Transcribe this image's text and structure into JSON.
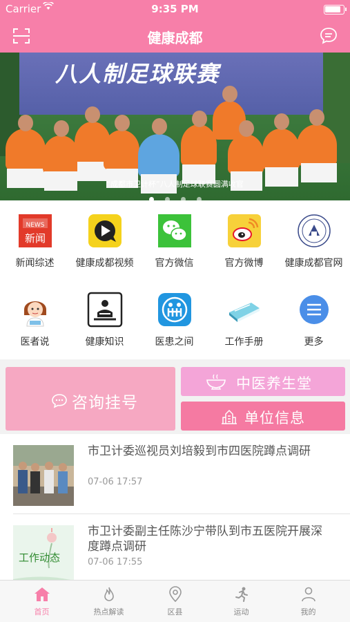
{
  "status": {
    "carrier": "Carrier",
    "time": "9:35 PM"
  },
  "nav": {
    "title": "健康成都"
  },
  "banner": {
    "sign_text": "八人制足球联赛",
    "caption": "“成都市卫计杯”八人制足球联赛圆满收官",
    "page_count": 4,
    "active_page": 1
  },
  "grid": {
    "items": [
      {
        "label": "新闻综述",
        "icon": "news-icon"
      },
      {
        "label": "健康成都视频",
        "icon": "video-icon"
      },
      {
        "label": "官方微信",
        "icon": "wechat-icon"
      },
      {
        "label": "官方微博",
        "icon": "weibo-icon"
      },
      {
        "label": "健康成都官网",
        "icon": "website-seal-icon"
      },
      {
        "label": "医者说",
        "icon": "doctor-avatar-icon"
      },
      {
        "label": "健康知识",
        "icon": "knowledge-icon"
      },
      {
        "label": "医患之间",
        "icon": "doctor-patient-icon"
      },
      {
        "label": "工作手册",
        "icon": "handbook-icon"
      },
      {
        "label": "更多",
        "icon": "more-icon"
      }
    ]
  },
  "services": {
    "consult": "咨询挂号",
    "tcm": "中医养生堂",
    "units": "单位信息"
  },
  "news": [
    {
      "title": "市卫计委巡视员刘培毅到市四医院蹲点调研",
      "time": "07-06 17:57"
    },
    {
      "title": "市卫计委副主任陈沙宁带队到市五医院开展深度蹲点调研",
      "time": "07-06 17:55",
      "thumb_text": "工作动态"
    }
  ],
  "tabs": [
    {
      "label": "首页",
      "icon": "home-icon"
    },
    {
      "label": "热点解读",
      "icon": "flame-icon"
    },
    {
      "label": "区县",
      "icon": "location-icon"
    },
    {
      "label": "运动",
      "icon": "running-icon"
    },
    {
      "label": "我的",
      "icon": "user-icon"
    }
  ],
  "colors": {
    "brand_pink": "#f77fa9",
    "consult_pink": "#f6a8c2",
    "tcm_pink": "#f4a5d8",
    "units_pink": "#f57aa2"
  }
}
